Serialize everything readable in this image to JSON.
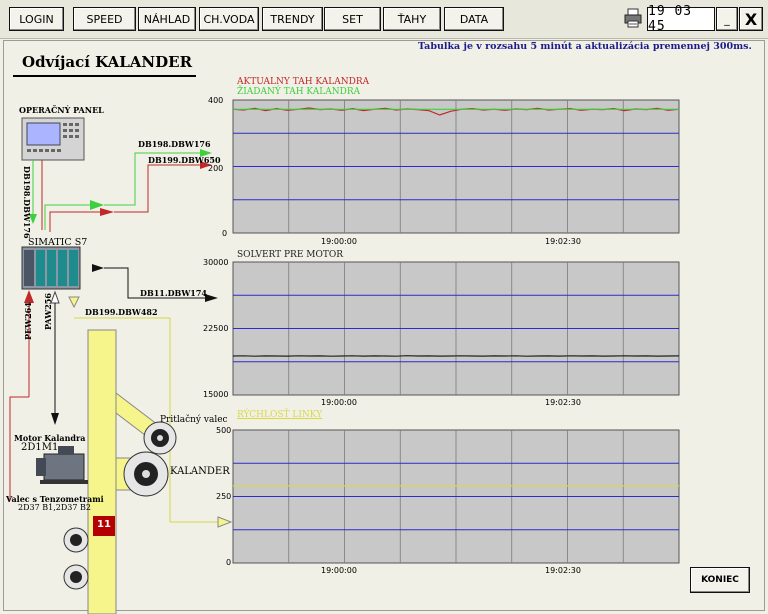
{
  "toolbar": {
    "buttons": [
      "LOGIN",
      "SPEED",
      "NÁHLAD",
      "CH.VODA",
      "TRENDY",
      "SET",
      "ŤAHY",
      "DATA"
    ],
    "clock": "19 03 45",
    "minimize_label": "_",
    "close_label": "X"
  },
  "info_text": "Tabulka je v rozsahu 5 minút  a aktualizácia premennej 300ms.",
  "page_title": "Odvíjací KALANDER",
  "diagram": {
    "operator_panel": "OPERAČNÝ PANEL",
    "db198_vertical": "DB198.DBW176",
    "db198_right": "DB198.DBW176",
    "db199_650": "DB199.DBW650",
    "simatic": "SIMATIC S7",
    "db11": "DB11.DBW174",
    "pew": "PEW264",
    "paw": "PAW256",
    "db199_482": "DB199.DBW482",
    "motor_title": "Motor Kalandra",
    "motor_id": "2D1M1",
    "roll_label": "Valec s Tenzometrami",
    "roll_ids": "2D37 B1,2D37 B2",
    "pressure_roll": "Pritlačný valec",
    "calender": "KALANDER",
    "badge": "11"
  },
  "colors": {
    "actual": "#c0282a",
    "setpoint": "#3ecf3e",
    "solvert": "#222222",
    "speed": "#d8d84a",
    "gridline": "#2c2cc8",
    "plot_bg": "#c8c8c8",
    "yellow": "#f5f58c"
  },
  "chart_data": [
    {
      "type": "line",
      "series": [
        {
          "name": "AKTUALNY TAH KALANDRA",
          "color": "#c0282a",
          "values": [
            372,
            370,
            375,
            368,
            374,
            369,
            372,
            376,
            371,
            373,
            369,
            374,
            368,
            372,
            375,
            370,
            373,
            371,
            368,
            355,
            366,
            372,
            374,
            370,
            372,
            369,
            373,
            371,
            375,
            370,
            372,
            374,
            369,
            372,
            371,
            374,
            368,
            373,
            371,
            375,
            369,
            372
          ]
        },
        {
          "name": "ŽIADANÝ TAH KALANDRA",
          "color": "#3ecf3e",
          "values": [
            372,
            372,
            372,
            372,
            372,
            372,
            372,
            372,
            372,
            372,
            372,
            372,
            372,
            372,
            372,
            372,
            372,
            372,
            372,
            372,
            372,
            372,
            372,
            372,
            372,
            372,
            372,
            372,
            372,
            372,
            372,
            372,
            372,
            372,
            372,
            372,
            372,
            372,
            372,
            372,
            372,
            372
          ]
        }
      ],
      "y_ticks": [
        "400",
        "200",
        "0"
      ],
      "x_ticks": [
        "19:00:00",
        "19:02:30"
      ],
      "ylim": [
        0,
        400
      ]
    },
    {
      "type": "line",
      "series": [
        {
          "name": "SOLVERT PRE MOTOR",
          "color": "#222222",
          "values": [
            19400,
            19420,
            19380,
            19410,
            19400,
            19390,
            19420,
            19400,
            19410,
            19380,
            19400,
            19420,
            19390,
            19410,
            19400,
            19380,
            19430,
            19400,
            19410,
            19390,
            19400,
            19420,
            19400,
            19390,
            19410,
            19400,
            19420,
            19380,
            19400,
            19410,
            19390,
            19420,
            19400,
            19410,
            19390,
            19400,
            19420,
            19400,
            19410,
            19390,
            19400,
            19410
          ]
        }
      ],
      "y_ticks": [
        "30000",
        "22500",
        "15000"
      ],
      "x_ticks": [
        "19:00:00",
        "19:02:30"
      ],
      "ylim": [
        15000,
        30000
      ]
    },
    {
      "type": "line",
      "series": [
        {
          "name": "RÝCHLOSŤ LINKY",
          "color": "#d8d84a",
          "values": [
            290,
            290,
            290,
            290,
            290,
            290,
            290,
            290,
            290,
            290,
            290,
            290,
            290,
            290,
            290,
            290,
            290,
            290,
            290,
            290,
            290,
            290,
            290,
            290,
            290,
            290,
            290,
            290,
            290,
            290,
            290,
            290,
            290,
            290,
            290,
            290,
            290,
            290,
            290,
            290,
            290,
            290
          ]
        }
      ],
      "y_ticks": [
        "500",
        "250",
        "0"
      ],
      "x_ticks": [
        "19:00:00",
        "19:02:30"
      ],
      "ylim": [
        0,
        500
      ]
    }
  ],
  "koniec_label": "KONIEC"
}
